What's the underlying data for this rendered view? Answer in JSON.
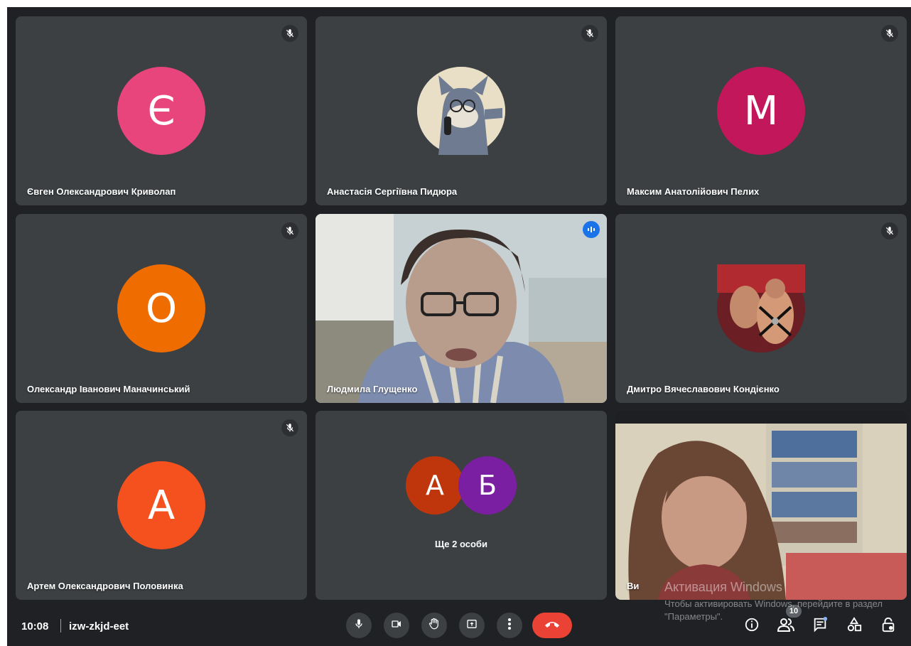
{
  "participants": [
    {
      "name": "Євген Олександрович Криволап",
      "initial": "Є",
      "color": "#e8457c"
    },
    {
      "name": "Анастасія Сергіївна Пидюра",
      "image": "cartoon-cat-avatar"
    },
    {
      "name": "Максим Анатолійович Пелих",
      "initial": "M",
      "color": "#c2185b"
    },
    {
      "name": "Олександр Іванович Маначинський",
      "initial": "O",
      "color": "#ef6c00"
    },
    {
      "name": "Людмила Глущенко",
      "image": "video-feed",
      "speaking": true
    },
    {
      "name": "Дмитро Вячеславович Кондієнко",
      "image": "photo-avatar"
    },
    {
      "name": "Артем Олександрович Половинка",
      "initial": "A",
      "color": "#f4511e"
    }
  ],
  "others": {
    "avatars": [
      {
        "initial": "A",
        "color": "#bf360c"
      },
      {
        "initial": "Б",
        "color": "#7b1fa2"
      }
    ],
    "label": "Ще 2 особи"
  },
  "self": {
    "name": "Ви"
  },
  "meeting": {
    "time": "10:08",
    "code": "izw-zkjd-eet"
  },
  "toolbar": {
    "mic_icon": "microphone-icon",
    "camera_icon": "camera-icon",
    "hand_icon": "raise-hand-icon",
    "present_icon": "present-screen-icon",
    "more_icon": "more-options-icon",
    "leave_icon": "leave-call-icon"
  },
  "side_toolbar": {
    "info_icon": "info-icon",
    "people_icon": "people-icon",
    "people_count": "10",
    "chat_icon": "chat-icon",
    "activities_icon": "activities-icon",
    "host_controls_icon": "host-controls-icon"
  },
  "windows_activation": {
    "title": "Активация Windows",
    "text": "Чтобы активировать Windows, перейдите в раздел \"Параметры\"."
  },
  "colors": {
    "background": "#202124",
    "tile": "#3c4043",
    "speaking_border": "#8ab4f8",
    "hangup": "#ea4335"
  }
}
